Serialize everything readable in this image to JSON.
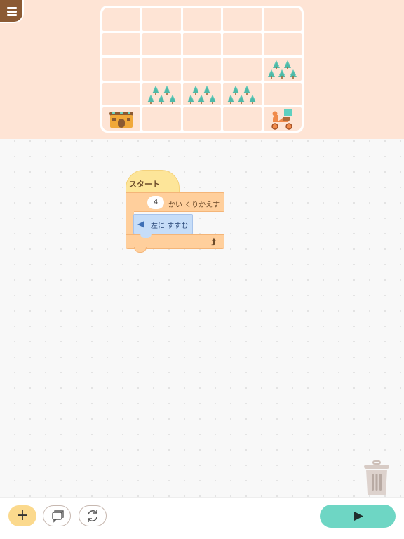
{
  "app": {
    "menu_icon": "hamburger-icon",
    "colors": {
      "stage_bg": "#fee4d5",
      "start_block": "#fde599",
      "repeat_block": "#ffcf9c",
      "move_block": "#c6ddf8",
      "play_button": "#6ed6c4"
    }
  },
  "stage": {
    "grid": [
      [
        "",
        "",
        "",
        "",
        ""
      ],
      [
        "",
        "",
        "",
        "",
        ""
      ],
      [
        "",
        "",
        "",
        "",
        "trees"
      ],
      [
        "",
        "trees",
        "trees",
        "trees",
        ""
      ],
      [
        "house",
        "",
        "",
        "",
        "scooter"
      ]
    ]
  },
  "blocks": {
    "start_label": "スタート",
    "repeat_count": "4",
    "repeat_label": "かい くりかえす",
    "move_label": "左に すすむ"
  },
  "toolbar": {
    "add_label": "+",
    "add_icon": "plus-icon",
    "comment_icon": "comment-icon",
    "reset_icon": "refresh-icon",
    "play_icon": "play-icon",
    "trash_icon": "trash-icon"
  }
}
